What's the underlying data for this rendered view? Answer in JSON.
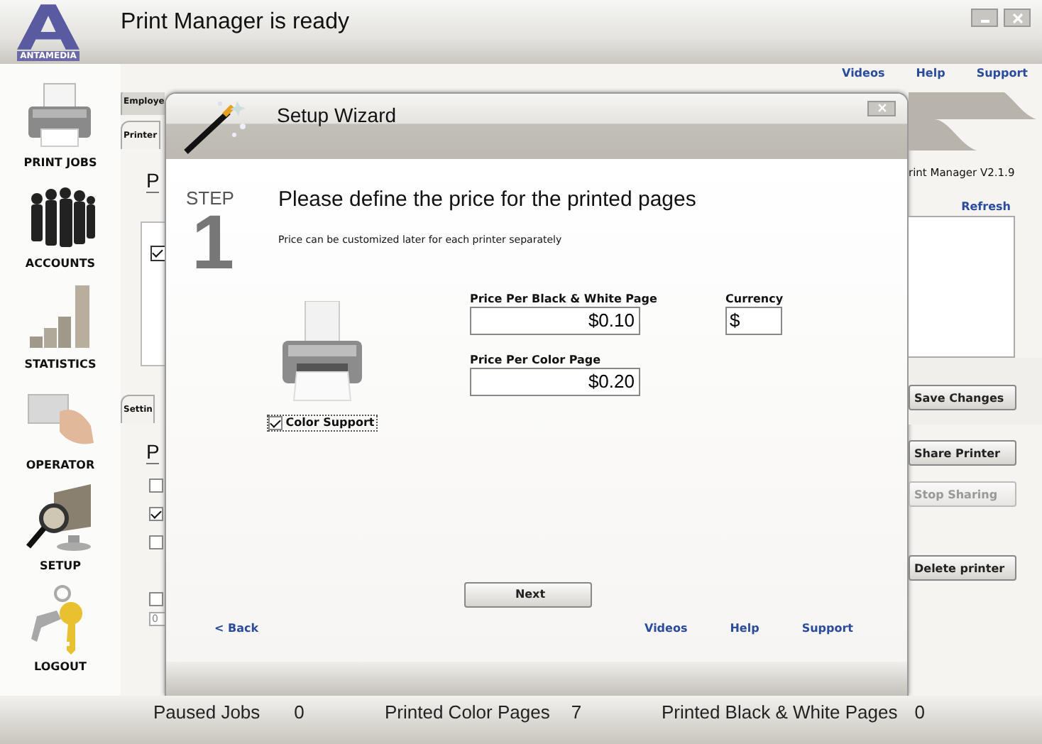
{
  "window": {
    "title": "Print Manager is ready",
    "logo": "ANTAMEDIA"
  },
  "top_links": [
    "Videos",
    "Help",
    "Support"
  ],
  "sidebar": {
    "items": [
      {
        "label": "PRINT JOBS",
        "kind": "printer"
      },
      {
        "label": "ACCOUNTS",
        "kind": "people"
      },
      {
        "label": "STATISTICS",
        "kind": "chart"
      },
      {
        "label": "OPERATOR",
        "kind": "card"
      },
      {
        "label": "SETUP",
        "kind": "monitor"
      },
      {
        "label": "LOGOUT",
        "kind": "keys"
      }
    ]
  },
  "background": {
    "tabs": [
      {
        "label": "Employe",
        "selected": false
      },
      {
        "label": "Printer",
        "selected": true
      }
    ],
    "heading": "P",
    "printer_checked": true,
    "settings_tab": {
      "label": "Settin",
      "selected": true
    },
    "settings_heading": "P",
    "options": [
      {
        "checked": false
      },
      {
        "checked": true
      },
      {
        "checked": false
      }
    ],
    "limit_checked": false,
    "limit_value": "0",
    "version": "rint Manager V2.1.9",
    "refresh": "Refresh",
    "save_button": {
      "label": "Save Changes",
      "disabled": false
    },
    "share_buttons": [
      {
        "label": "Share Printer",
        "disabled": false
      },
      {
        "label": "Stop Sharing",
        "disabled": true
      }
    ],
    "delete_button": {
      "label": "Delete printer",
      "disabled": false
    }
  },
  "dialog": {
    "title": "Setup Wizard",
    "step_label": "STEP",
    "step_number": "1",
    "heading": "Please define the price for the printed pages",
    "subtitle": "Price can be customized later for each printer separately",
    "color_support": {
      "label": "Color Support",
      "checked": true
    },
    "bw_price": {
      "label": "Price Per Black & White Page",
      "value": "$0.10"
    },
    "currency": {
      "label": "Currency",
      "value": "$"
    },
    "color_price": {
      "label": "Price Per Color Page",
      "value": "$0.20"
    },
    "next": "Next",
    "back": "< Back",
    "links": [
      "Videos",
      "Help",
      "Support"
    ]
  },
  "status_bar": [
    {
      "label": "Paused Jobs",
      "value": "0"
    },
    {
      "label": "Printed Color Pages",
      "value": "7"
    },
    {
      "label": "Printed Black & White Pages",
      "value": "0"
    }
  ]
}
